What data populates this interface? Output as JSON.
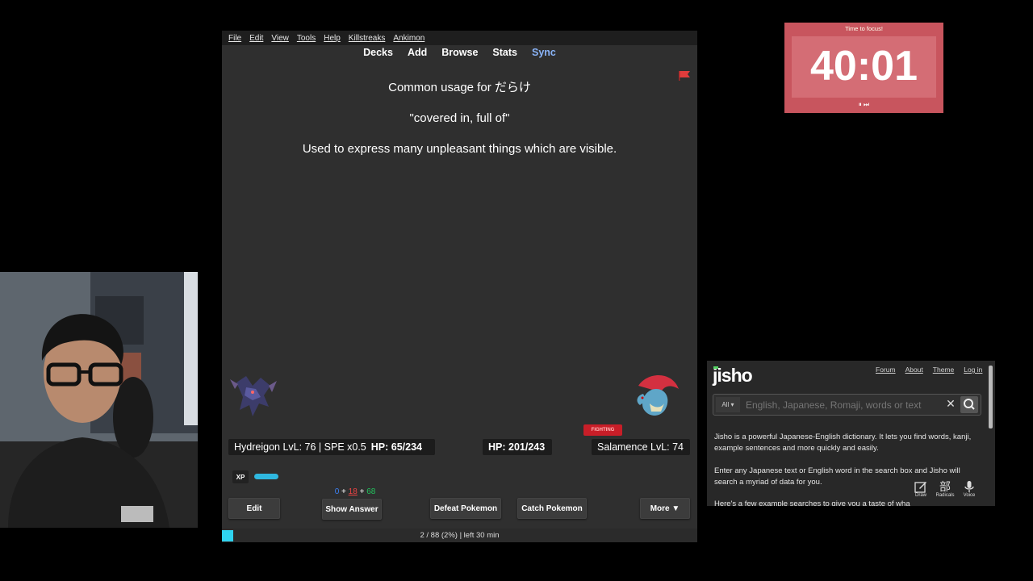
{
  "anki": {
    "menu": [
      "File",
      "Edit",
      "View",
      "Tools",
      "Help",
      "Killstreaks",
      "Ankimon"
    ],
    "tabs": {
      "decks": "Decks",
      "add": "Add",
      "browse": "Browse",
      "stats": "Stats",
      "sync": "Sync"
    },
    "card": {
      "heading": "Common usage for だらけ",
      "meaning": "\"covered in, full of\"",
      "explanation": "Used to express many unpleasant things which are visible."
    },
    "battle": {
      "player_info": "Hydreigon LvL: 76 | SPE x0.5",
      "player_hp": "HP: 65/234",
      "enemy_hp": "HP: 201/243",
      "enemy_info": "Salamence LvL: 74",
      "enemy_type": "FIGHTING",
      "xp_label": "XP",
      "xp_fraction": 0.6
    },
    "counts": {
      "new": "0",
      "learn": "18",
      "review": "68",
      "plus": "+"
    },
    "buttons": {
      "edit": "Edit",
      "show_answer": "Show Answer",
      "defeat": "Defeat Pokemon",
      "catch": "Catch Pokemon",
      "more": "More ▼"
    },
    "status": "2 / 88 (2%) | left 30 min",
    "colors": {
      "new": "#3b82f6",
      "learn": "#ef4444",
      "review": "#22c55e",
      "accent": "#8ab4f8"
    }
  },
  "timer": {
    "label": "Time to focus!",
    "time": "40:01",
    "controls": "⏸ ⏭"
  },
  "jisho": {
    "logo": "jisho",
    "nav": [
      "Forum",
      "About",
      "Theme",
      "Log in"
    ],
    "filter": "All ▾",
    "placeholder": "English, Japanese, Romaji, words or text",
    "para1": "Jisho is a powerful Japanese-English dictionary. It lets you find words, kanji, example sentences and more quickly and easily.",
    "para2": "Enter any Japanese text or English word in the search box and Jisho will search a myriad of data for you.",
    "para3": "Here's a few example searches to give you a taste of wha",
    "tools": {
      "draw": "Draw",
      "radicals": "Radicals",
      "voice": "Voice",
      "radicals_glyph": "部"
    }
  }
}
